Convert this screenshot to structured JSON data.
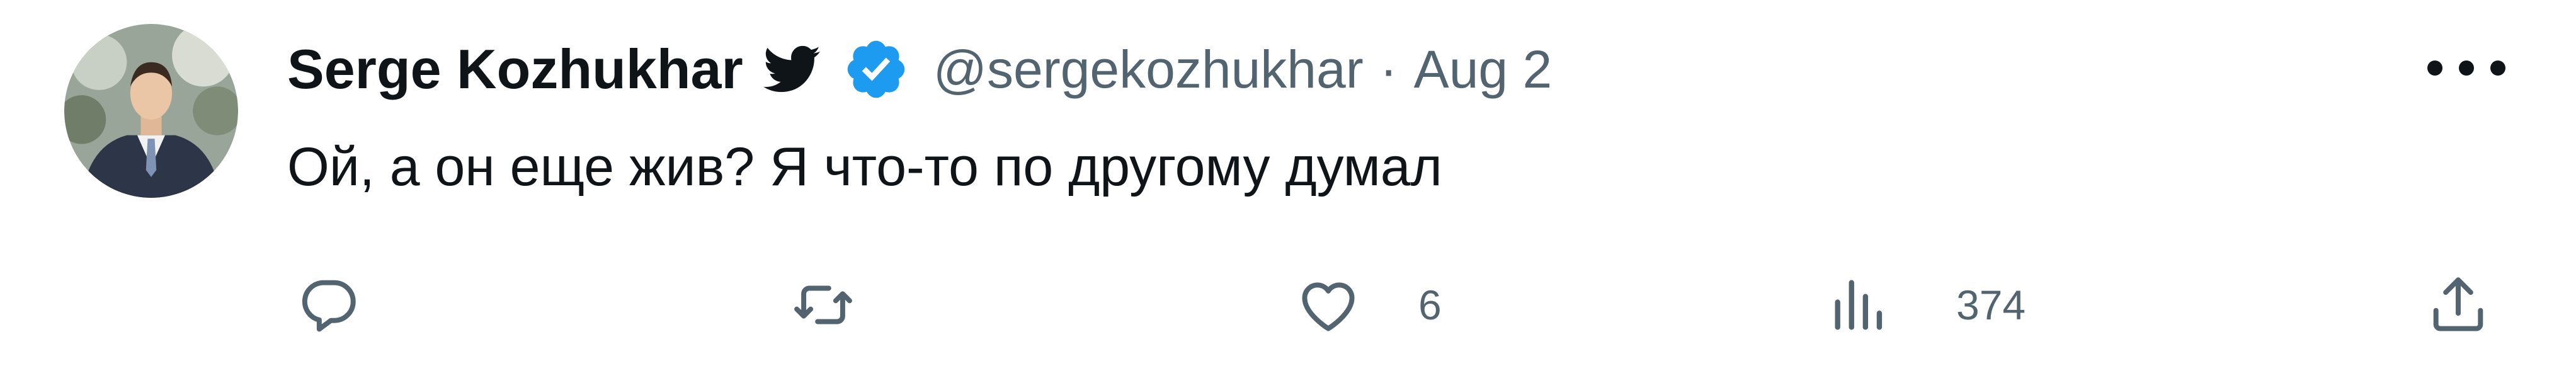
{
  "tweet": {
    "display_name": "Serge Kozhukhar",
    "handle": "@sergekozhukhar",
    "separator": "·",
    "date": "Aug 2",
    "text": "Ой, а он еще жив? Я что-то по другому думал",
    "icons": {
      "bird": "twitter-bird-icon",
      "verified": "verified-badge-icon",
      "more": "more-options-icon"
    },
    "colors": {
      "verified": "#1d9bf0",
      "muted": "#536471",
      "text": "#0f1419"
    }
  },
  "actions": {
    "reply": {
      "icon": "reply-icon",
      "count": ""
    },
    "retweet": {
      "icon": "retweet-icon",
      "count": ""
    },
    "like": {
      "icon": "heart-icon",
      "count": "6"
    },
    "views": {
      "icon": "views-chart-icon",
      "count": "374"
    },
    "share": {
      "icon": "share-icon",
      "count": ""
    }
  }
}
